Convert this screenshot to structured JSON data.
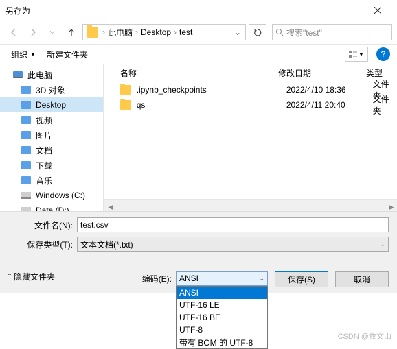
{
  "title": "另存为",
  "path": {
    "root": "此电脑",
    "p1": "Desktop",
    "p2": "test"
  },
  "search_placeholder": "搜索\"test\"",
  "toolbar": {
    "organize": "组织",
    "newfolder": "新建文件夹"
  },
  "columns": {
    "name": "名称",
    "date": "修改日期",
    "type": "类型"
  },
  "sidebar": {
    "items": [
      {
        "label": "此电脑"
      },
      {
        "label": "3D 对象"
      },
      {
        "label": "Desktop"
      },
      {
        "label": "视频"
      },
      {
        "label": "图片"
      },
      {
        "label": "文档"
      },
      {
        "label": "下载"
      },
      {
        "label": "音乐"
      },
      {
        "label": "Windows (C:)"
      },
      {
        "label": "Data (D:)"
      }
    ]
  },
  "files": [
    {
      "name": ".ipynb_checkpoints",
      "date": "2022/4/10 18:36",
      "type": "文件夹"
    },
    {
      "name": "qs",
      "date": "2022/4/11 20:40",
      "type": "文件夹"
    }
  ],
  "form": {
    "filename_label": "文件名(N):",
    "filename_value": "test.csv",
    "type_label": "保存类型(T):",
    "type_value": "文本文档(*.txt)",
    "encoding_label": "编码(E):",
    "encoding_value": "ANSI",
    "encoding_options": [
      "ANSI",
      "UTF-16 LE",
      "UTF-16 BE",
      "UTF-8",
      "带有 BOM 的 UTF-8"
    ]
  },
  "buttons": {
    "hide": "隐藏文件夹",
    "save": "保存(S)",
    "cancel": "取消"
  },
  "watermark": "CSDN @牧文山"
}
